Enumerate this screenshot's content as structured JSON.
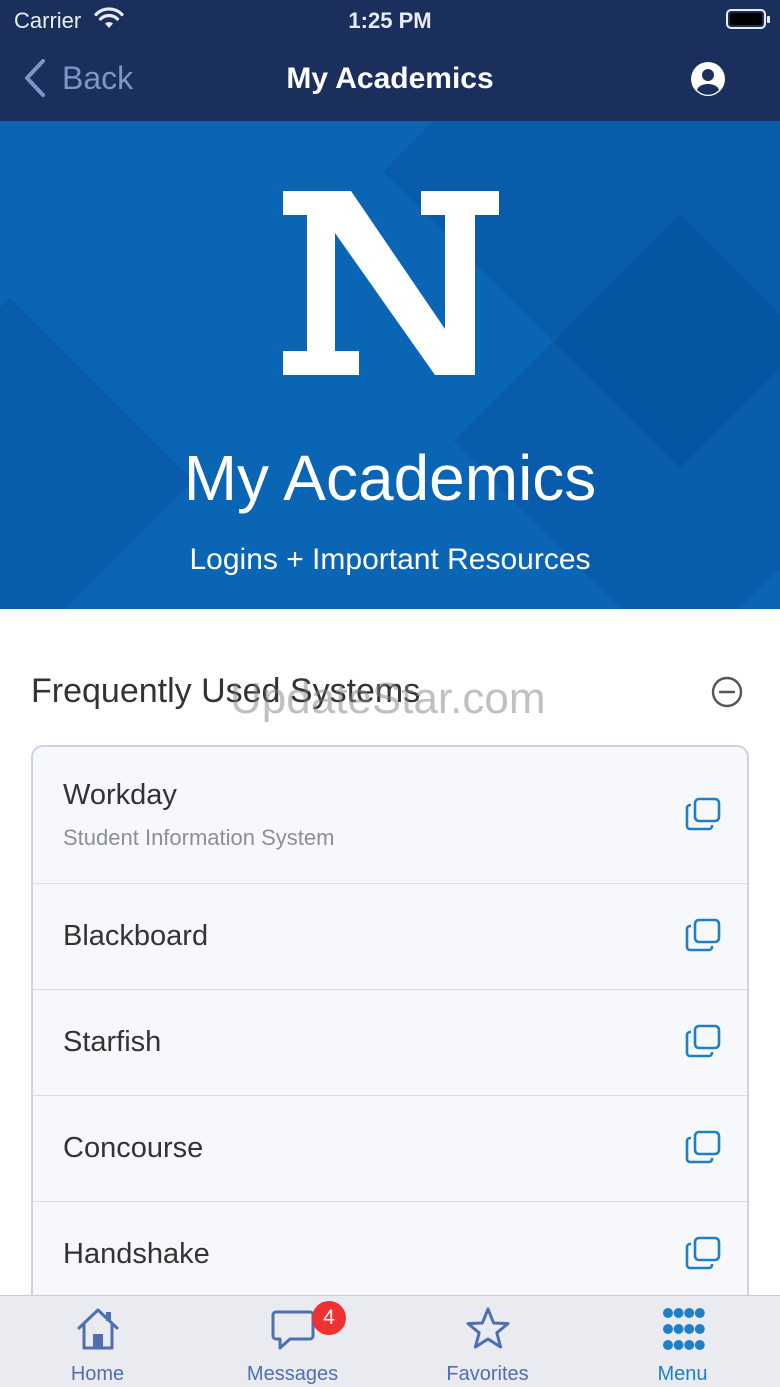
{
  "status_bar": {
    "carrier": "Carrier",
    "time": "1:25 PM"
  },
  "nav": {
    "back_label": "Back",
    "title": "My Academics"
  },
  "hero": {
    "title": "My Academics",
    "subtitle": "Logins + Important Resources",
    "logo_letter": "N"
  },
  "section": {
    "title": "Frequently Used Systems"
  },
  "watermark": "UpdateStar.com",
  "systems": [
    {
      "name": "Workday",
      "subtitle": "Student Information System"
    },
    {
      "name": "Blackboard"
    },
    {
      "name": "Starfish"
    },
    {
      "name": "Concourse"
    },
    {
      "name": "Handshake"
    }
  ],
  "tabs": [
    {
      "label": "Home",
      "icon": "home-icon"
    },
    {
      "label": "Messages",
      "icon": "messages-icon",
      "badge": "4"
    },
    {
      "label": "Favorites",
      "icon": "star-icon"
    },
    {
      "label": "Menu",
      "icon": "grid-menu-icon"
    }
  ],
  "colors": {
    "nav_bg": "#1b2f5c",
    "hero_bg": "#0a65b5",
    "accent": "#1f7ec4",
    "badge": "#ee3131"
  }
}
